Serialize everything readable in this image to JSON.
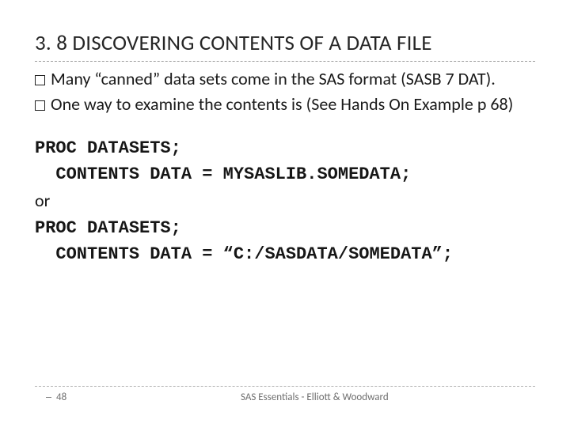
{
  "title": "3. 8 DISCOVERING CONTENTS OF A DATA FILE",
  "bullets": [
    "Many “canned” data sets come in the SAS format (SASB 7 DAT).",
    "One way to examine the contents is (See Hands On Example p 68)"
  ],
  "code": {
    "line1": "PROC DATASETS;",
    "line2": "  CONTENTS DATA = MYSASLIB.SOMEDATA;",
    "or": "or",
    "line3": "PROC DATASETS;",
    "line4": "  CONTENTS DATA = “C:/SASDATA/SOMEDATA”;"
  },
  "footer": {
    "page": "48",
    "center": "SAS Essentials - Elliott & Woodward"
  }
}
